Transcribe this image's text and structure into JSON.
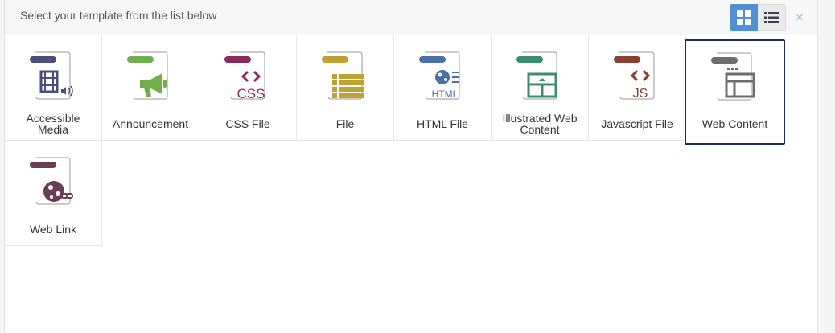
{
  "header": {
    "title": "Select your template from the list below",
    "grid_view_icon": "grid-icon",
    "list_view_icon": "list-icon",
    "close_icon": "×"
  },
  "colors": {
    "accent": "#4f8fd6",
    "selected_border": "#1b2a6b",
    "close": "#9eb9d8"
  },
  "templates": [
    {
      "label_line1": "Accessible",
      "label_line2": "Media",
      "icon": "accessible-media-icon",
      "color": "#4b4f7d",
      "selected": false
    },
    {
      "label_line1": "Announcement",
      "label_line2": "",
      "icon": "announcement-icon",
      "color": "#6fb04c",
      "selected": false
    },
    {
      "label_line1": "CSS File",
      "label_line2": "",
      "icon": "css-file-icon",
      "color": "#8c2b5c",
      "selected": false
    },
    {
      "label_line1": "File",
      "label_line2": "",
      "icon": "file-icon",
      "color": "#c1a033",
      "selected": false
    },
    {
      "label_line1": "HTML File",
      "label_line2": "",
      "icon": "html-file-icon",
      "color": "#4b6fa8",
      "selected": false
    },
    {
      "label_line1": "Illustrated Web",
      "label_line2": "Content",
      "icon": "illustrated-web-content-icon",
      "color": "#3e8b73",
      "selected": false
    },
    {
      "label_line1": "Javascript File",
      "label_line2": "",
      "icon": "javascript-file-icon",
      "color": "#8a3f32",
      "selected": false
    },
    {
      "label_line1": "Web Content",
      "label_line2": "",
      "icon": "web-content-icon",
      "color": "#6d6d6d",
      "selected": true
    },
    {
      "label_line1": "Web Link",
      "label_line2": "",
      "icon": "web-link-icon",
      "color": "#6c3e52",
      "selected": false
    }
  ],
  "icon_text": {
    "css": "CSS",
    "html": "HTML",
    "js": "JS"
  }
}
